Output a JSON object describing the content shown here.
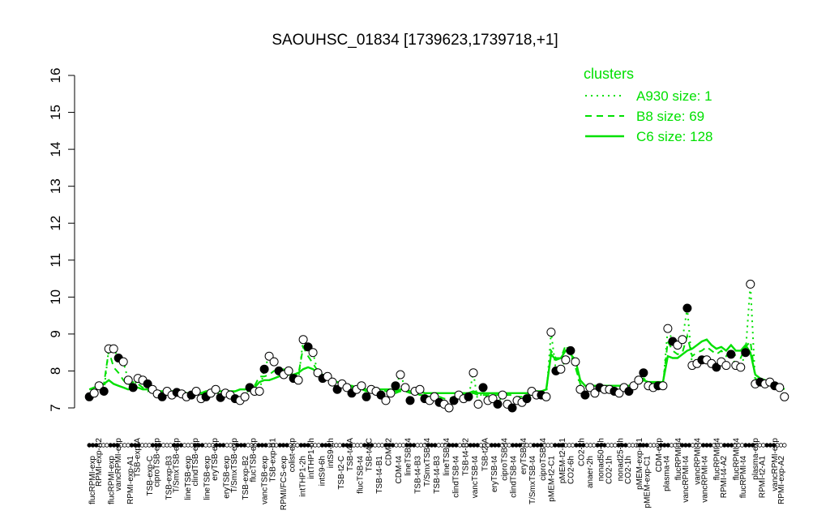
{
  "chart_data": {
    "type": "line",
    "title": "SAOUHSC_01834 [1739623,1739718,+1]",
    "ylim": [
      7,
      16
    ],
    "yticks": [
      7,
      8,
      9,
      10,
      11,
      12,
      13,
      14,
      15,
      16
    ],
    "xlabels_bottom": [
      "flucRPMI-exp",
      "flucRPMI-exp",
      "RPMI-exp-A1",
      "TSB-exp-C",
      "TSB-exp-B3",
      "lineTSB-exp",
      "lineTSB-exp",
      "eryTSB-exp",
      "TSB-exp-B2",
      "vancTSB-exp",
      "RPMI/FCS-exp",
      "intTHP1-2h",
      "intS9-6h",
      "TSB-t2-C",
      "flucTSB-t4",
      "TSB-t4-B1",
      "CDM-t4",
      "TSB-t4-B3",
      "TSB-t4-B3",
      "clindTSB-t4",
      "vancTSB-t4",
      "eryTSB-t4",
      "clindTSB-t4",
      "T/SmxTSB-t4",
      "pMEM-t2-C1",
      "CO2-6h",
      "anaer-2h",
      "CO2-1h",
      "CO2-1h",
      "pMEM-exp-C1",
      "plasma-t4",
      "vancRPMI-t4",
      "vancRPMI-t4",
      "RPMI-t4-A2",
      "flucRPMI-t4",
      "RPMI-t2-A1",
      "RPMI-exp-A2"
    ],
    "xlabels_top": [
      "RPMI-exp-A2",
      "vancRPMI-exp",
      "TSB-exp-A",
      "ciproTSB-exp",
      "T/SmxTSB-exp",
      "clindTSB-exp",
      "eryTSB-exp",
      "T/SmxTSB-exp",
      "flucTSB-exp",
      "TSB-exp-B1",
      "colist-exp",
      "intTHP1-6h",
      "intS9-2h",
      "TSB-t4-A",
      "TSB-t4-C",
      "CDM-t2",
      "lineTSB-t4",
      "T/SmxTSB-t4",
      "lineTSB-t4",
      "TSB-t4-B2",
      "TSB-t2-A",
      "ciproTSB-t4",
      "eryTSB-t4",
      "ciproTSB-t4",
      "pMEM-t2-B1",
      "CO2-2h",
      "nonad50-6h",
      "nonad25-6h",
      "pMEM-exp-B1",
      "CDM-exp",
      "flucRPMI-t4",
      "vancRPMI-t4",
      "flucRPMI-t4",
      "flucRPMI-t4",
      "plasma-exp",
      "vancRPMI-exp"
    ],
    "legend": {
      "title": "clusters",
      "position": "top-right",
      "entries": [
        {
          "label": "A930 size: 1",
          "style": "dotted"
        },
        {
          "label": "B8 size: 69",
          "style": "dashed"
        },
        {
          "label": "C6 size: 128",
          "style": "solid"
        }
      ]
    },
    "colors": {
      "series": "#00e000",
      "point_stroke": "#000000",
      "axis": "#000000"
    },
    "x_count": 198,
    "series": [
      {
        "name": "A930 size: 1",
        "style": "dotted",
        "values": [
          7.3,
          7.4,
          7.6,
          7.45,
          8.6,
          8.6,
          8.35,
          8.25,
          7.75,
          7.55,
          7.8,
          7.75,
          7.65,
          7.5,
          7.38,
          7.3,
          7.45,
          7.35,
          7.42,
          7.38,
          7.3,
          7.35,
          7.45,
          7.25,
          7.3,
          7.4,
          7.5,
          7.28,
          7.4,
          7.35,
          7.25,
          7.2,
          7.3,
          7.55,
          7.45,
          7.45,
          8.05,
          8.4,
          8.25,
          8.0,
          7.9,
          8.0,
          7.8,
          7.75,
          8.85,
          8.65,
          8.5,
          7.95,
          7.8,
          7.85,
          7.7,
          7.5,
          7.65,
          7.55,
          7.4,
          7.5,
          7.6,
          7.3,
          7.5,
          7.45,
          7.35,
          7.2,
          7.4,
          7.6,
          7.9,
          7.55,
          7.2,
          7.45,
          7.5,
          7.25,
          7.2,
          7.3,
          7.15,
          7.1,
          7.0,
          7.2,
          7.35,
          7.25,
          7.3,
          7.95,
          7.1,
          7.55,
          7.2,
          7.25,
          7.1,
          7.35,
          7.1,
          7.0,
          7.2,
          7.15,
          7.25,
          7.45,
          7.35,
          7.35,
          7.3,
          9.05,
          8.0,
          8.05,
          8.3,
          8.55,
          8.25,
          7.5,
          7.35,
          7.55,
          7.4,
          7.55,
          7.5,
          7.5,
          7.45,
          7.4,
          7.55,
          7.45,
          7.6,
          7.75,
          7.95,
          7.6,
          7.55,
          7.6,
          7.6,
          9.15,
          8.8,
          8.7,
          8.85,
          9.7,
          8.15,
          8.2,
          8.3,
          8.3,
          8.2,
          8.1,
          8.25,
          8.15,
          8.45,
          8.15,
          8.1,
          8.5,
          10.35,
          7.65,
          7.7,
          7.65,
          7.7,
          7.6,
          7.55,
          7.3
        ]
      },
      {
        "name": "B8 size: 69",
        "style": "dashed",
        "values": [
          7.5,
          7.55,
          7.6,
          7.65,
          8.55,
          8.1,
          7.95,
          7.75,
          7.6,
          7.7,
          7.65,
          7.55,
          7.45,
          7.5,
          7.45,
          7.4,
          7.4,
          7.45,
          7.4,
          7.45,
          7.4,
          7.4,
          7.45,
          7.35,
          7.4,
          7.45,
          7.45,
          7.4,
          7.45,
          7.45,
          7.45,
          7.5,
          7.5,
          7.55,
          7.6,
          7.85,
          7.85,
          7.9,
          8.0,
          8.0,
          8.05,
          7.95,
          7.9,
          7.9,
          8.65,
          8.4,
          8.2,
          8.0,
          7.9,
          7.85,
          7.75,
          7.65,
          7.6,
          7.55,
          7.55,
          7.5,
          7.5,
          7.45,
          7.45,
          7.45,
          7.5,
          7.45,
          7.45,
          7.4,
          7.45,
          7.45,
          7.4,
          7.4,
          7.35,
          7.35,
          7.3,
          7.3,
          7.3,
          7.25,
          7.25,
          7.3,
          7.3,
          7.3,
          7.35,
          7.4,
          7.35,
          7.35,
          7.35,
          7.35,
          7.35,
          7.4,
          7.35,
          7.35,
          7.3,
          7.3,
          7.35,
          7.35,
          7.4,
          7.4,
          7.45,
          8.55,
          8.35,
          8.35,
          8.7,
          8.45,
          8.1,
          7.65,
          7.55,
          7.55,
          7.55,
          7.55,
          7.55,
          7.55,
          7.55,
          7.55,
          7.55,
          7.55,
          7.6,
          7.7,
          7.8,
          7.7,
          7.65,
          7.65,
          7.65,
          8.8,
          8.55,
          8.45,
          8.5,
          8.95,
          8.4,
          8.5,
          8.55,
          8.65,
          8.55,
          8.45,
          8.55,
          8.4,
          8.6,
          8.4,
          8.35,
          8.65,
          8.8,
          7.8,
          7.7,
          7.65,
          7.65,
          7.6,
          7.55,
          7.45
        ]
      },
      {
        "name": "C6 size: 128",
        "style": "solid",
        "values": [
          7.5,
          7.55,
          7.6,
          7.65,
          7.75,
          7.65,
          7.6,
          7.55,
          7.5,
          7.55,
          7.55,
          7.5,
          7.5,
          7.45,
          7.45,
          7.45,
          7.45,
          7.45,
          7.45,
          7.45,
          7.4,
          7.4,
          7.45,
          7.4,
          7.45,
          7.45,
          7.45,
          7.45,
          7.45,
          7.45,
          7.45,
          7.5,
          7.5,
          7.55,
          7.55,
          7.7,
          7.75,
          7.75,
          7.8,
          7.85,
          7.9,
          7.9,
          7.9,
          7.95,
          8.05,
          8.1,
          8.05,
          7.95,
          7.85,
          7.8,
          7.75,
          7.7,
          7.65,
          7.6,
          7.6,
          7.55,
          7.55,
          7.5,
          7.5,
          7.5,
          7.5,
          7.5,
          7.5,
          7.45,
          7.5,
          7.5,
          7.45,
          7.45,
          7.45,
          7.4,
          7.4,
          7.4,
          7.4,
          7.4,
          7.4,
          7.4,
          7.4,
          7.4,
          7.4,
          7.45,
          7.4,
          7.4,
          7.4,
          7.4,
          7.4,
          7.4,
          7.4,
          7.4,
          7.4,
          7.4,
          7.4,
          7.4,
          7.45,
          7.45,
          7.5,
          8.45,
          8.3,
          8.35,
          8.55,
          8.45,
          8.3,
          7.75,
          7.6,
          7.6,
          7.6,
          7.6,
          7.6,
          7.6,
          7.6,
          7.6,
          7.6,
          7.6,
          7.65,
          7.7,
          7.75,
          7.7,
          7.7,
          7.7,
          7.7,
          8.4,
          8.35,
          8.35,
          8.45,
          8.55,
          8.6,
          8.7,
          8.8,
          8.85,
          8.7,
          8.6,
          8.65,
          8.55,
          8.7,
          8.55,
          8.55,
          8.7,
          8.5,
          7.9,
          7.8,
          7.75,
          7.7,
          7.65,
          7.6,
          7.5
        ]
      }
    ]
  }
}
